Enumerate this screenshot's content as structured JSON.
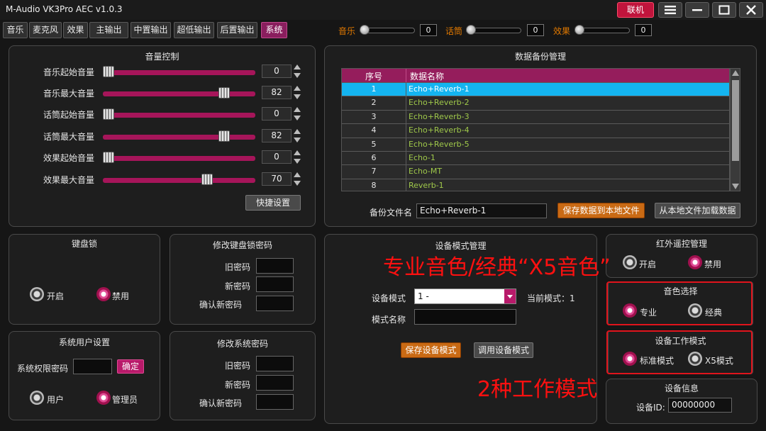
{
  "app": {
    "title": "M-Audio VK3Pro AEC  v1.0.3",
    "connect_label": "联机"
  },
  "tabs": [
    {
      "label": "音乐"
    },
    {
      "label": "麦克风"
    },
    {
      "label": "效果"
    },
    {
      "label": "主输出"
    },
    {
      "label": "中置输出"
    },
    {
      "label": "超低输出"
    },
    {
      "label": "后置输出"
    },
    {
      "label": "系统",
      "active": true
    }
  ],
  "top_sliders": [
    {
      "label": "音乐",
      "value": "0",
      "level": 0
    },
    {
      "label": "话筒",
      "value": "0",
      "level": 0
    },
    {
      "label": "效果",
      "value": "0",
      "level": 0
    }
  ],
  "volume_panel": {
    "title": "音量控制",
    "rows": [
      {
        "label": "音乐起始音量",
        "value": "0",
        "level": 0.0
      },
      {
        "label": "音乐最大音量",
        "value": "82",
        "level": 0.82
      },
      {
        "label": "话筒起始音量",
        "value": "0",
        "level": 0.0
      },
      {
        "label": "话筒最大音量",
        "value": "82",
        "level": 0.82
      },
      {
        "label": "效果起始音量",
        "value": "0",
        "level": 0.0
      },
      {
        "label": "效果最大音量",
        "value": "70",
        "level": 0.7
      }
    ],
    "quick_button": "快捷设置"
  },
  "backup_panel": {
    "title": "数据备份管理",
    "headers": [
      "序号",
      "数据名称"
    ],
    "rows": [
      {
        "no": "1",
        "name": "Echo+Reverb-1",
        "selected": true
      },
      {
        "no": "2",
        "name": "Echo+Reverb-2"
      },
      {
        "no": "3",
        "name": "Echo+Reverb-3"
      },
      {
        "no": "4",
        "name": "Echo+Reverb-4"
      },
      {
        "no": "5",
        "name": "Echo+Reverb-5"
      },
      {
        "no": "6",
        "name": "Echo-1"
      },
      {
        "no": "7",
        "name": "Echo-MT"
      },
      {
        "no": "8",
        "name": "Reverb-1"
      }
    ],
    "filename_label": "备份文件名",
    "filename_value": "Echo+Reverb-1",
    "save_button": "保存数据到本地文件",
    "load_button": "从本地文件加载数据"
  },
  "keylock_panel": {
    "title": "键盘锁",
    "on_label": "开启",
    "off_label": "禁用",
    "selected": "off"
  },
  "keylock_pwd_panel": {
    "title": "修改键盘锁密码",
    "old_label": "旧密码",
    "new_label": "新密码",
    "confirm_label": "确认新密码"
  },
  "sys_user_panel": {
    "title": "系统用户设置",
    "pwd_label": "系统权限密码",
    "confirm_button": "确定",
    "user_label": "用户",
    "admin_label": "管理员",
    "selected": "admin"
  },
  "sys_pwd_panel": {
    "title": "修改系统密码",
    "old_label": "旧密码",
    "new_label": "新密码",
    "confirm_label": "确认新密码"
  },
  "device_mode_panel": {
    "title": "设备模式管理",
    "mode_label": "设备模式",
    "mode_value": "1 -",
    "current_mode_label": "当前模式：1",
    "name_label": "模式名称",
    "save_button": "保存设备模式",
    "load_button": "调用设备模式"
  },
  "ir_panel": {
    "title": "红外遥控管理",
    "on_label": "开启",
    "off_label": "禁用",
    "selected": "off"
  },
  "tone_panel": {
    "title": "音色选择",
    "pro_label": "专业",
    "classic_label": "经典",
    "selected": "pro"
  },
  "workmode_panel": {
    "title": "设备工作模式",
    "std_label": "标准模式",
    "x5_label": "X5模式",
    "selected": "std"
  },
  "device_info_panel": {
    "title": "设备信息",
    "id_label": "设备ID:",
    "id_value": "00000000"
  },
  "annotations": {
    "tone_note": "专业音色/经典“X5音色”",
    "mode_note": "2种工作模式"
  },
  "colors": {
    "accent": "#b81a6a",
    "slider_track": "#a6155a",
    "annotation": "#ff1010",
    "selected_row": "#14b4f0",
    "table_text": "#9fc84a",
    "top_slider_label": "#e07800"
  }
}
